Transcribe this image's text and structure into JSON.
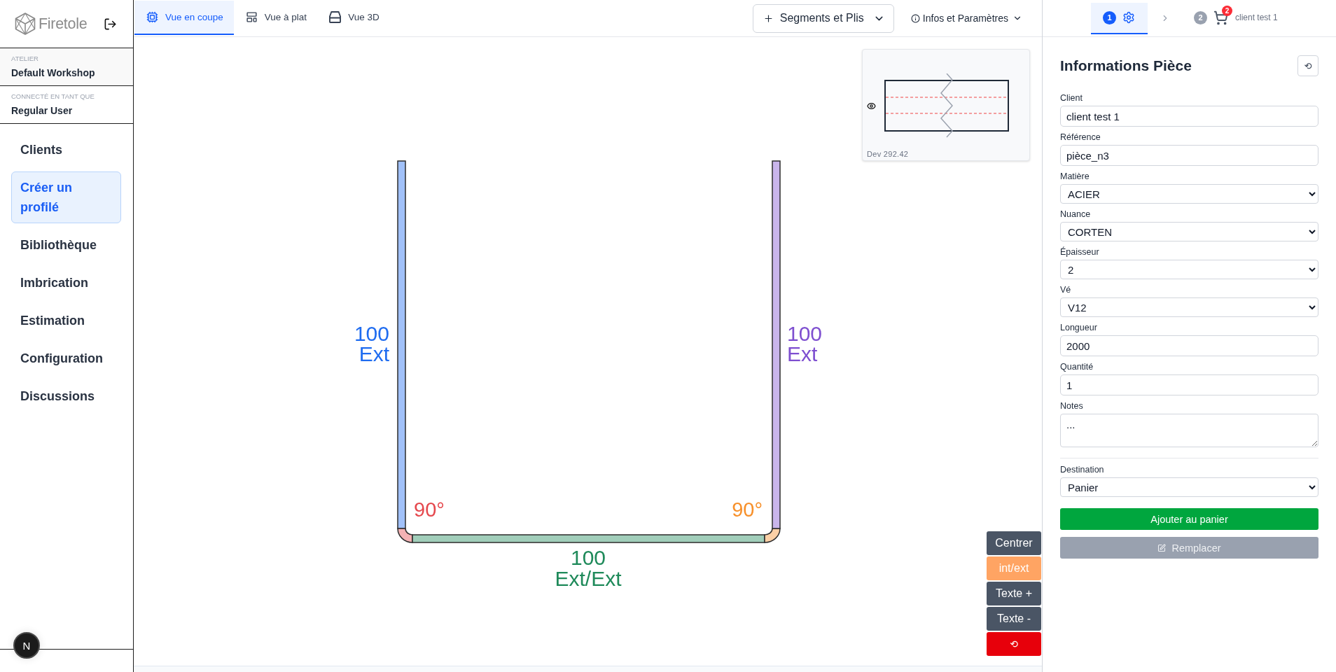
{
  "sidebar": {
    "brand": "Firetole",
    "workshop": {
      "label": "ATELIER",
      "value": "Default Workshop"
    },
    "user": {
      "label": "CONNECTÉ EN TANT QUE",
      "value": "Regular User"
    },
    "nav": [
      {
        "label": "Clients",
        "selected": false
      },
      {
        "label": "Créer un profilé",
        "selected": true
      },
      {
        "label": "Bibliothèque",
        "selected": false
      },
      {
        "label": "Imbrication",
        "selected": false
      },
      {
        "label": "Estimation",
        "selected": false
      },
      {
        "label": "Configuration",
        "selected": false
      },
      {
        "label": "Discussions",
        "selected": false
      }
    ],
    "dev_badge": "N"
  },
  "toolbar": {
    "tabs": [
      {
        "label": "Vue en coupe",
        "selected": true
      },
      {
        "label": "Vue à plat",
        "selected": false
      },
      {
        "label": "Vue 3D",
        "selected": false
      }
    ],
    "segments_button": "Segments et Plis",
    "settings_menu": "Infos et Paramètres"
  },
  "canvas": {
    "profile": {
      "parts": [
        {
          "kind": "segment",
          "length": "100",
          "side": "Ext",
          "color": "#1f6cf0"
        },
        {
          "kind": "bend",
          "angle": "90°",
          "color": "#e5484d"
        },
        {
          "kind": "segment",
          "length": "100",
          "side": "Ext/Ext",
          "color": "#1f8a5a"
        },
        {
          "kind": "bend",
          "angle": "90°",
          "color": "#f7902a"
        },
        {
          "kind": "segment",
          "length": "100",
          "side": "Ext",
          "color": "#7e4fd0"
        }
      ]
    },
    "preview": {
      "caption": "Dev 292.42"
    },
    "tools": [
      {
        "label": "Centrer",
        "kind": "action"
      },
      {
        "label": "int/ext",
        "kind": "highlight"
      },
      {
        "label": "Texte +",
        "kind": "action"
      },
      {
        "label": "Texte -",
        "kind": "action"
      },
      {
        "label": "⟲",
        "kind": "danger"
      }
    ]
  },
  "panel": {
    "steps": [
      {
        "number": "1",
        "selected": true
      },
      {
        "number": "2",
        "selected": false,
        "badge": "2",
        "caption": "client test 1"
      }
    ],
    "title": "Informations Pièce",
    "reset_button": "⟲",
    "fields": [
      {
        "label": "Client",
        "kind": "text",
        "value": "client test 1"
      },
      {
        "label": "Référence",
        "kind": "text",
        "value": "pièce_n3"
      },
      {
        "label": "Matière",
        "kind": "select",
        "value": "ACIER"
      },
      {
        "label": "Nuance",
        "kind": "select",
        "value": "CORTEN"
      },
      {
        "label": "Épaisseur",
        "kind": "select",
        "value": "2"
      },
      {
        "label": "Vé",
        "kind": "select",
        "value": "V12"
      },
      {
        "label": "Longueur",
        "kind": "text",
        "value": "2000"
      },
      {
        "label": "Quantité",
        "kind": "text",
        "value": "1"
      },
      {
        "label": "Notes",
        "kind": "textarea",
        "value": "..."
      }
    ],
    "destination": {
      "label": "Destination",
      "kind": "select",
      "value": "Panier"
    },
    "buttons": [
      {
        "label": "Ajouter au panier",
        "disabled": false
      },
      {
        "label": "Remplacer",
        "disabled": true
      }
    ]
  }
}
